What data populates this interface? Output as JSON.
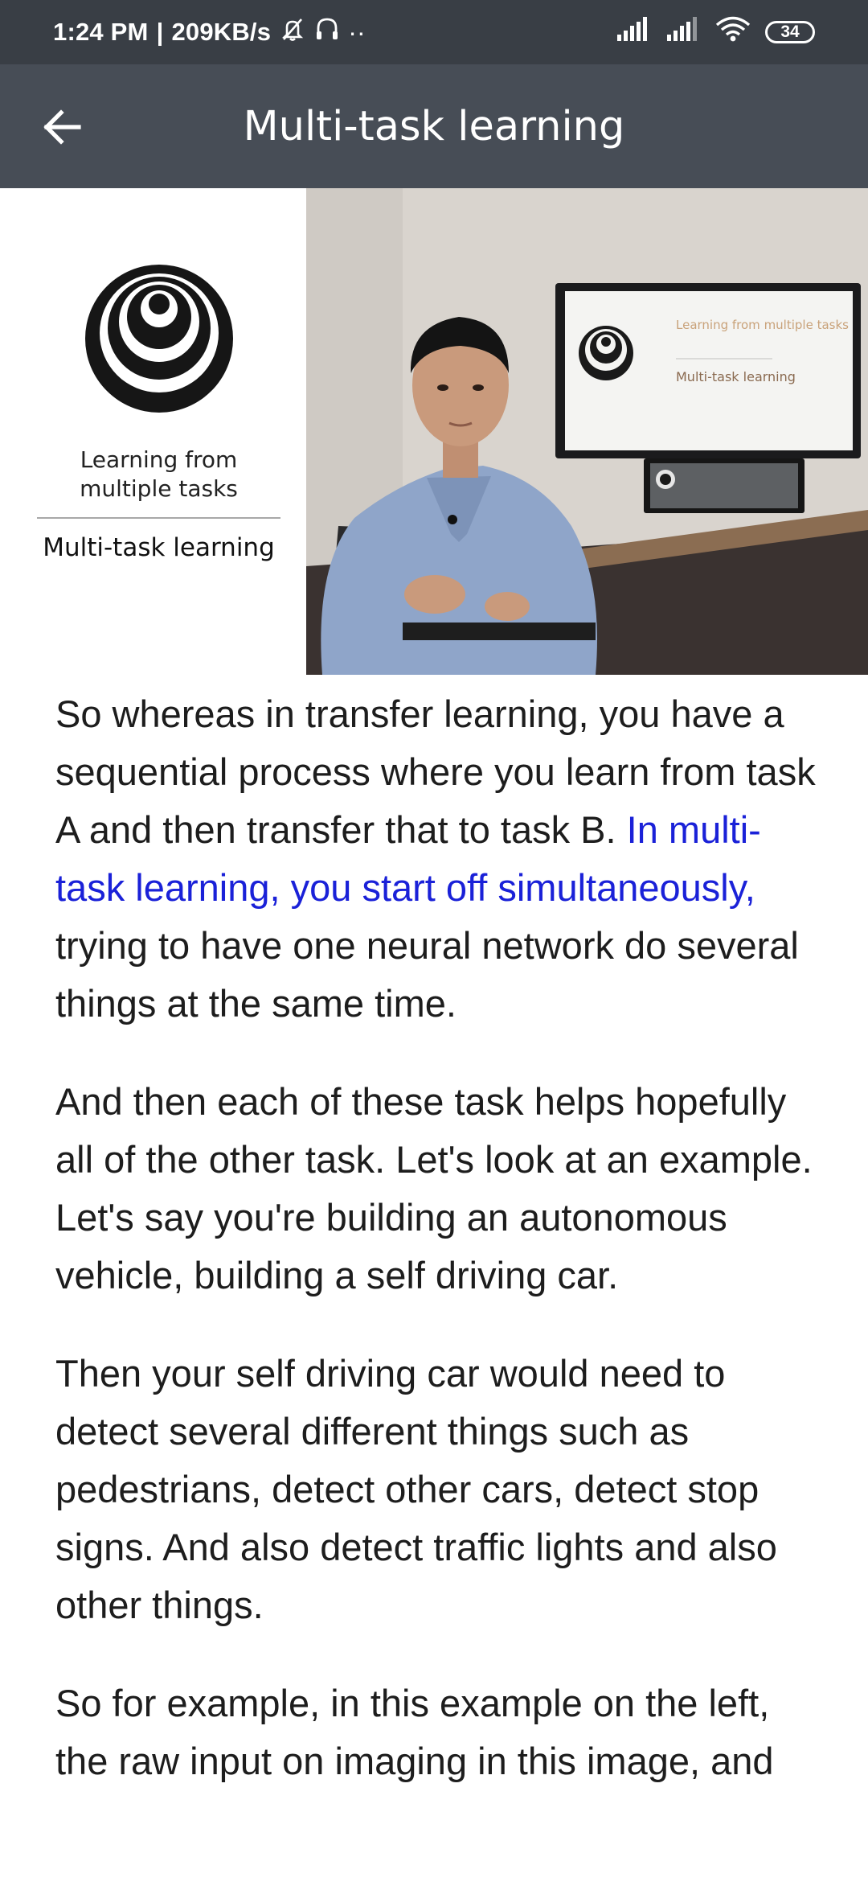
{
  "status_bar": {
    "time": "1:24 PM",
    "separator": "|",
    "network_speed": "209KB/s",
    "battery_level": "34",
    "overflow_dots": "··"
  },
  "app_bar": {
    "title": "Multi-task learning"
  },
  "slide": {
    "subtitle": "Learning from multiple tasks",
    "topic": "Multi-task learning"
  },
  "video": {
    "screen_text_1": "Learning from multiple tasks",
    "screen_text_2": "Multi-task learning"
  },
  "transcript": {
    "p1_before": "So whereas in transfer learning, you have a sequential process where you learn from task A and then transfer that to task B. ",
    "p1_highlight": "In multi-task learning, you start off simultaneously,",
    "p1_after": " trying to have one neural network do several things at the same time.",
    "p2": "And then each of these task helps hopefully all of the other task. Let's look at an example. Let's say you're building an autonomous vehicle, building a self driving car.",
    "p3": "Then your self driving car would need to detect several different things such as pedestrians, detect other cars, detect stop signs. And also detect traffic lights and also other things.",
    "p4": "So for example, in this example on the left, the raw input on imaging in this image, and"
  },
  "colors": {
    "status_bar_bg": "#393e45",
    "app_bar_bg": "#474d56",
    "highlight_text": "#1a21d8",
    "body_text": "#1d1d1d"
  }
}
